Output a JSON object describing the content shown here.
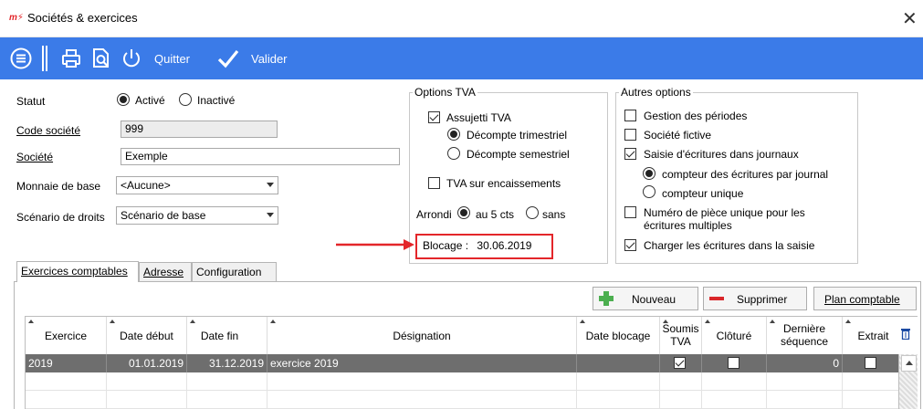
{
  "window": {
    "logo": "m⚡",
    "title": "Sociétés & exercices",
    "close": "✕"
  },
  "toolbar": {
    "quit_label": "Quitter",
    "validate_label": "Valider"
  },
  "form": {
    "statut_label": "Statut",
    "statut_options": [
      "Activé",
      "Inactivé"
    ],
    "statut_selected": "Activé",
    "code_label": "Code société",
    "code_value": "999",
    "societe_label": "Société",
    "societe_value": "Exemple",
    "monnaie_label": "Monnaie de base",
    "monnaie_value": "<Aucune>",
    "scenario_label": "Scénario de droits",
    "scenario_value": "Scénario de base"
  },
  "tva": {
    "legend": "Options TVA",
    "assujetti": "Assujetti TVA",
    "trimestriel": "Décompte trimestriel",
    "semestriel": "Décompte semestriel",
    "encaissements": "TVA sur encaissements",
    "arrondi_label": "Arrondi",
    "arrondi_5": "au 5 cts",
    "arrondi_sans": "sans",
    "blocage_label": "Blocage :",
    "blocage_value": "30.06.2019"
  },
  "autres": {
    "legend": "Autres options",
    "gestion_periodes": "Gestion des périodes",
    "societe_fictive": "Société fictive",
    "saisie_journaux": "Saisie d'écritures dans journaux",
    "compteur_journal": "compteur des écritures par journal",
    "compteur_unique": "compteur unique",
    "numero_piece_1": "Numéro de pièce unique pour les",
    "numero_piece_2": "écritures multiples",
    "charger": "Charger les écritures dans la saisie"
  },
  "tabs": {
    "exercices": "Exercices comptables",
    "adresse": "Adresse",
    "configuration": "Configuration"
  },
  "actions": {
    "nouveau": "Nouveau",
    "supprimer": "Supprimer",
    "plan": "Plan comptable"
  },
  "grid": {
    "headers": {
      "exercice": "Exercice",
      "date_debut": "Date début",
      "date_fin": "Date fin",
      "designation": "Désignation",
      "date_blocage": "Date blocage",
      "soumis_1": "Soumis",
      "soumis_2": "TVA",
      "cloture": "Clôturé",
      "derniere_1": "Dernière",
      "derniere_2": "séquence",
      "extrait": "Extrait"
    },
    "row": {
      "exercice": "2019",
      "date_debut": "01.01.2019",
      "date_fin": "31.12.2019",
      "designation": "exercice 2019",
      "date_blocage": "",
      "soumis_tva": true,
      "cloture": false,
      "derniere_sequence": "0",
      "extrait": false
    }
  },
  "colors": {
    "toolbar": "#3b7be8",
    "highlight": "#e3262a",
    "selected_row": "#6e6e6e"
  }
}
